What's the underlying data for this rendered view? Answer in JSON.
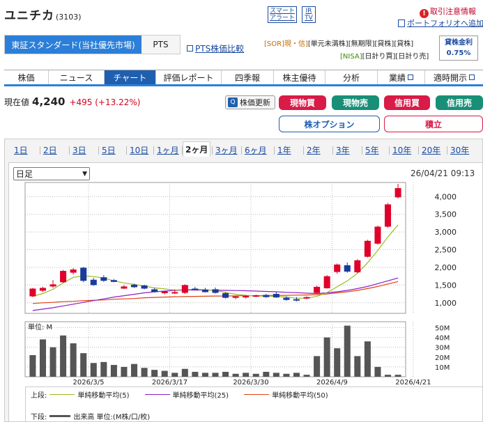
{
  "header": {
    "company_name": "ユニチカ",
    "code": "(3103)",
    "smart_alert": [
      "スマート",
      "アラート"
    ],
    "ir_tv": [
      "IR",
      "TV"
    ],
    "alert_link": "取引注意情報",
    "portfolio_link": "ポートフォリオへ追加"
  },
  "market_tabs": {
    "primary": "東証スタンダード(当社優先市場)",
    "pts": "PTS",
    "pts_compare": "PTS株価比較"
  },
  "tags": {
    "line1": [
      "[SOR]現・信]",
      "[単元未満株]",
      "[無期限]",
      "[貸株]",
      "[貸株]"
    ],
    "line2": [
      "[NISA]",
      "[日計り買]",
      "[日計り売]"
    ]
  },
  "lending_rate": {
    "label": "貸株金利",
    "value": "0.75%"
  },
  "nav_tabs": [
    "株価",
    "ニュース",
    "チャート",
    "評価レポート",
    "四季報",
    "株主優待",
    "分析",
    "業績",
    "適時開示"
  ],
  "nav_active": "チャート",
  "price": {
    "label": "現在値",
    "value": "4,240",
    "change": "+495 (+13.22%)"
  },
  "actions": {
    "refresh": "株価更新",
    "genbutsu_buy": "現物買",
    "genbutsu_sell": "現物売",
    "shinyo_buy": "信用買",
    "shinyo_sell": "信用売",
    "option": "株オプション",
    "tsumitate": "積立"
  },
  "period_tabs": [
    "1日",
    "2日",
    "3日",
    "5日",
    "10日",
    "1ヶ月",
    "2ヶ月",
    "3ヶ月",
    "6ヶ月",
    "1年",
    "2年",
    "3年",
    "5年",
    "10年",
    "20年",
    "30年"
  ],
  "period_active": "2ヶ月",
  "chart_controls": {
    "select_value": "日足",
    "timestamp": "26/04/21 09:13",
    "volume_unit_label": "単位: M"
  },
  "legend": {
    "upper_label": "上段:",
    "lower_label": "下段:",
    "ma5": "単純移動平均(5)",
    "ma25": "単純移動平均(25)",
    "ma50": "単純移動平均(50)",
    "volume": "出来高 単位:(M株/口/枚)"
  },
  "colors": {
    "up": "#e0002a",
    "down": "#1a3a9c",
    "ma5": "#9bbb1c",
    "ma25": "#8a1cc8",
    "ma50": "#e04010",
    "volume": "#555555",
    "accent": "#2b7fd8"
  },
  "chart_data": {
    "type": "candlestick",
    "price_ticks": [
      1000,
      1500,
      2000,
      2500,
      3000,
      3500,
      4000
    ],
    "price_tick_labels": [
      "1,000",
      "1,500",
      "2,000",
      "2,500",
      "3,000",
      "3,500",
      "4,000"
    ],
    "price_range": [
      700,
      4400
    ],
    "volume_ticks": [
      10,
      20,
      30,
      40,
      50
    ],
    "volume_tick_labels": [
      "10M",
      "20M",
      "30M",
      "40M",
      "50M"
    ],
    "volume_range": [
      0,
      56
    ],
    "x_labels": [
      "2026/3/5",
      "2026/3/17",
      "2026/3/30",
      "2026/4/9",
      "2026/4/21"
    ],
    "x_label_index": [
      6,
      14,
      22,
      30,
      38
    ],
    "candles": [
      [
        1180,
        1420,
        1160,
        1400
      ],
      [
        1340,
        1450,
        1300,
        1420
      ],
      [
        1460,
        1640,
        1420,
        1520
      ],
      [
        1580,
        1930,
        1560,
        1900
      ],
      [
        1850,
        1980,
        1800,
        1940
      ],
      [
        1990,
        2010,
        1580,
        1620
      ],
      [
        1650,
        1700,
        1480,
        1500
      ],
      [
        1720,
        1780,
        1590,
        1620
      ],
      [
        1640,
        1670,
        1580,
        1590
      ],
      [
        1400,
        1500,
        1390,
        1460
      ],
      [
        1510,
        1540,
        1420,
        1440
      ],
      [
        1490,
        1510,
        1380,
        1400
      ],
      [
        1380,
        1420,
        1290,
        1300
      ],
      [
        1270,
        1330,
        1240,
        1320
      ],
      [
        1290,
        1380,
        1250,
        1300
      ],
      [
        1280,
        1520,
        1250,
        1500
      ],
      [
        1400,
        1450,
        1360,
        1380
      ],
      [
        1370,
        1420,
        1290,
        1300
      ],
      [
        1380,
        1430,
        1260,
        1280
      ],
      [
        1270,
        1300,
        1120,
        1140
      ],
      [
        1140,
        1200,
        1100,
        1180
      ],
      [
        1150,
        1220,
        1120,
        1200
      ],
      [
        1190,
        1230,
        1160,
        1210
      ],
      [
        1220,
        1250,
        1140,
        1160
      ],
      [
        1250,
        1300,
        1140,
        1150
      ],
      [
        1140,
        1180,
        1060,
        1080
      ],
      [
        1100,
        1160,
        1040,
        1060
      ],
      [
        1120,
        1180,
        1100,
        1160
      ],
      [
        1280,
        1480,
        1260,
        1450
      ],
      [
        1410,
        1780,
        1400,
        1750
      ],
      [
        1870,
        2110,
        1820,
        2080
      ],
      [
        2060,
        2140,
        1850,
        1880
      ],
      [
        1860,
        2230,
        1840,
        2200
      ],
      [
        2300,
        2780,
        2280,
        2750
      ],
      [
        2670,
        3180,
        2640,
        3150
      ],
      [
        3150,
        3820,
        3120,
        3780
      ],
      [
        3980,
        4360,
        3950,
        4240
      ]
    ],
    "ma5": [
      1180,
      1260,
      1380,
      1560,
      1720,
      1760,
      1740,
      1700,
      1620,
      1560,
      1520,
      1470,
      1420,
      1390,
      1360,
      1370,
      1380,
      1370,
      1350,
      1290,
      1240,
      1210,
      1190,
      1190,
      1180,
      1160,
      1130,
      1130,
      1180,
      1290,
      1450,
      1620,
      1830,
      2130,
      2480,
      2860,
      3200
    ],
    "ma25": [
      780,
      820,
      860,
      910,
      960,
      1010,
      1060,
      1110,
      1160,
      1200,
      1240,
      1280,
      1310,
      1330,
      1350,
      1360,
      1360,
      1360,
      1355,
      1350,
      1345,
      1340,
      1330,
      1320,
      1310,
      1295,
      1285,
      1270,
      1260,
      1280,
      1310,
      1350,
      1400,
      1460,
      1540,
      1620,
      1700
    ],
    "ma50": [
      980,
      1000,
      1010,
      1030,
      1040,
      1060,
      1070,
      1080,
      1100,
      1110,
      1120,
      1140,
      1150,
      1160,
      1170,
      1175,
      1180,
      1185,
      1190,
      1190,
      1195,
      1200,
      1200,
      1205,
      1210,
      1210,
      1215,
      1220,
      1230,
      1250,
      1280,
      1310,
      1350,
      1400,
      1460,
      1530,
      1600
    ],
    "volume": [
      22,
      38,
      30,
      42,
      34,
      24,
      14,
      15,
      12,
      10,
      13,
      9,
      7,
      6,
      4,
      8,
      5,
      4,
      4,
      5,
      3,
      4,
      3,
      5,
      4,
      3,
      4,
      2,
      21,
      40,
      29,
      52,
      21,
      36,
      10,
      2,
      2
    ]
  }
}
